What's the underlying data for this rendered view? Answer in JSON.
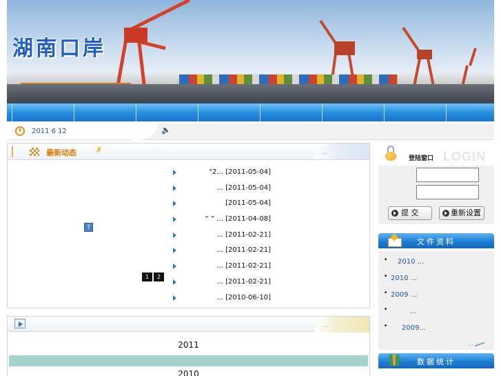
{
  "banner": {
    "logo_text": "湖南口岸"
  },
  "datebar": {
    "date": "2011 6 12"
  },
  "news": {
    "title": "最新动态",
    "more": "...",
    "items": [
      {
        "text": "\"2... [2011-05-04]"
      },
      {
        "text": "... [2011-05-04]"
      },
      {
        "text": "[2011-05-04]"
      },
      {
        "text": "“  ” ... [2011-04-08]"
      },
      {
        "text": "... [2011-02-21]"
      },
      {
        "text": "... [2011-02-21]"
      },
      {
        "text": "... [2011-02-21]"
      },
      {
        "text": "... [2011-02-21]"
      },
      {
        "text": "... [2010-06-10]"
      }
    ],
    "help_icon_text": "?",
    "pages": [
      "1",
      "2"
    ]
  },
  "panel2": {
    "more": "...",
    "years": [
      "2011",
      "2010"
    ]
  },
  "login": {
    "title": "登陆窗口",
    "title_en": "LOGIN",
    "submit_label": "提 交",
    "reset_label": "重新设置"
  },
  "files": {
    "title": "文件资料",
    "items": [
      {
        "text": "2010 ..."
      },
      {
        "text": "2010    ..."
      },
      {
        "text": "2009    ..."
      },
      {
        "text": "..."
      },
      {
        "text": "2009..."
      }
    ],
    "more": "..."
  },
  "stats": {
    "title": "数据统计"
  }
}
